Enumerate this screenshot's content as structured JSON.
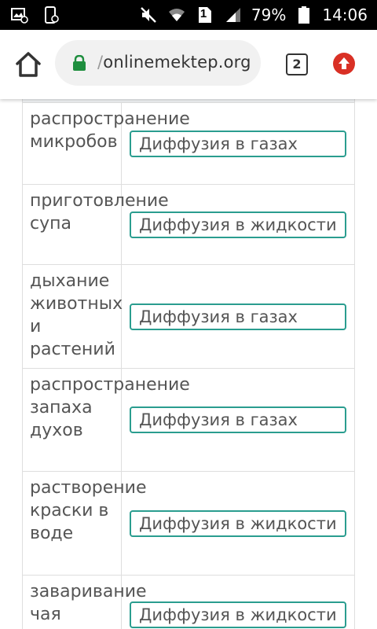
{
  "status_bar": {
    "battery": "79%",
    "time": "14:06",
    "sim_slot": "1",
    "icons": [
      "image-notification-icon",
      "screenshot-icon",
      "mute-icon",
      "wifi-icon",
      "sim-icon",
      "signal-icon",
      "battery-icon"
    ]
  },
  "browser": {
    "url": "onlinemektep.org",
    "tab_count": "2",
    "icons": [
      "home-icon",
      "lock-icon",
      "tabs-icon",
      "update-icon"
    ]
  },
  "table": {
    "rows": [
      {
        "term": "распространение микробов",
        "answer": "Диффузия в газах"
      },
      {
        "term": "приготовление супа",
        "answer": "Диффузия в жидкости"
      },
      {
        "term": "дыхание животных и растений",
        "answer": "Диффузия в газах"
      },
      {
        "term": "распространение запаха духов",
        "answer": "Диффузия в газах"
      },
      {
        "term": "растворение краски в воде",
        "answer": "Диффузия в жидкости"
      },
      {
        "term": "заваривание чая",
        "answer": "Диффузия в жидкости"
      }
    ]
  },
  "colors": {
    "answer_border": "#2a9d8f",
    "lock": "#1e8e3e",
    "update_button": "#d93025",
    "status_bar": "#000000"
  }
}
